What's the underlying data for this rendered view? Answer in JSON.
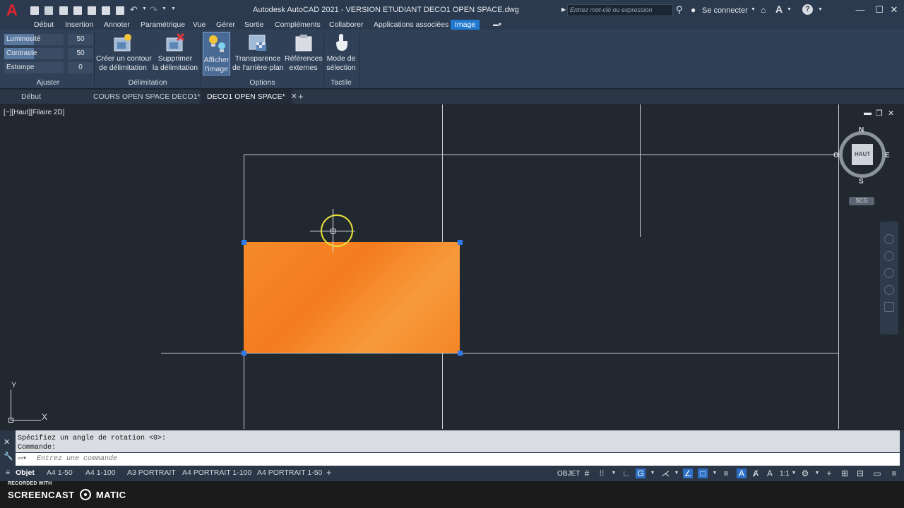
{
  "app": {
    "title": "Autodesk AutoCAD 2021 - VERSION ETUDIANT    DECO1 OPEN SPACE.dwg",
    "search_placeholder": "Entrez mot-clé ou expression",
    "sign_in": "Se connecter",
    "logo_letter": "A"
  },
  "menu_tabs": [
    "Début",
    "Insertion",
    "Annoter",
    "Paramétrique",
    "Vue",
    "Gérer",
    "Sortie",
    "Compléments",
    "Collaborer",
    "Applications associées",
    "Image"
  ],
  "ribbon": {
    "adjust": {
      "rows": [
        {
          "label": "Luminosité",
          "value": "50"
        },
        {
          "label": "Contraste",
          "value": "50"
        },
        {
          "label": "Estompe",
          "value": "0"
        }
      ],
      "title": "Ajuster"
    },
    "delimitation": {
      "buttons": [
        {
          "line1": "Créer un contour",
          "line2": "de délimitation"
        },
        {
          "line1": "Supprimer",
          "line2": "la délimitation"
        }
      ],
      "title": "Délimitation"
    },
    "options": {
      "buttons": [
        {
          "line1": "Afficher",
          "line2": "l'image"
        },
        {
          "line1": "Transparence",
          "line2": "de l'arrière-plan"
        },
        {
          "line1": "Références",
          "line2": "externes"
        }
      ],
      "title": "Options"
    },
    "tactile": {
      "buttons": [
        {
          "line1": "Mode de",
          "line2": "sélection"
        }
      ],
      "title": "Tactile"
    }
  },
  "doc_tabs": [
    {
      "label": "Début"
    },
    {
      "label": "COURS OPEN SPACE DECO1*"
    },
    {
      "label": "DECO1 OPEN SPACE*"
    }
  ],
  "viewport": {
    "label": "[−][Haut][Filaire 2D]"
  },
  "viewcube": {
    "face": "HAUT",
    "north": "N",
    "south": "S",
    "east": "E",
    "west": "O",
    "ucs_menu": "SCG"
  },
  "ucs": {
    "x": "X",
    "y": "Y"
  },
  "command": {
    "history": [
      "Spécifiez un angle de rotation <0>:",
      "Commande:"
    ],
    "placeholder": "Entrez une commande"
  },
  "layout_tabs": [
    "Objet",
    "A4 1-50",
    "A4 1-100",
    "A3 PORTRAIT",
    "A4 PORTRAIT 1-100",
    "A4 PORTRAIT 1-50"
  ],
  "status": {
    "model": "OBJET",
    "scale": "1:1"
  },
  "recording": {
    "small": "RECORDED WITH",
    "big_left": "SCREENCAST",
    "big_right": "MATIC"
  },
  "colors": {
    "image_fill": "#f58a2a",
    "accent": "#1f79d1",
    "grip": "#2f7bf0",
    "cursor": "#e8e23a"
  }
}
